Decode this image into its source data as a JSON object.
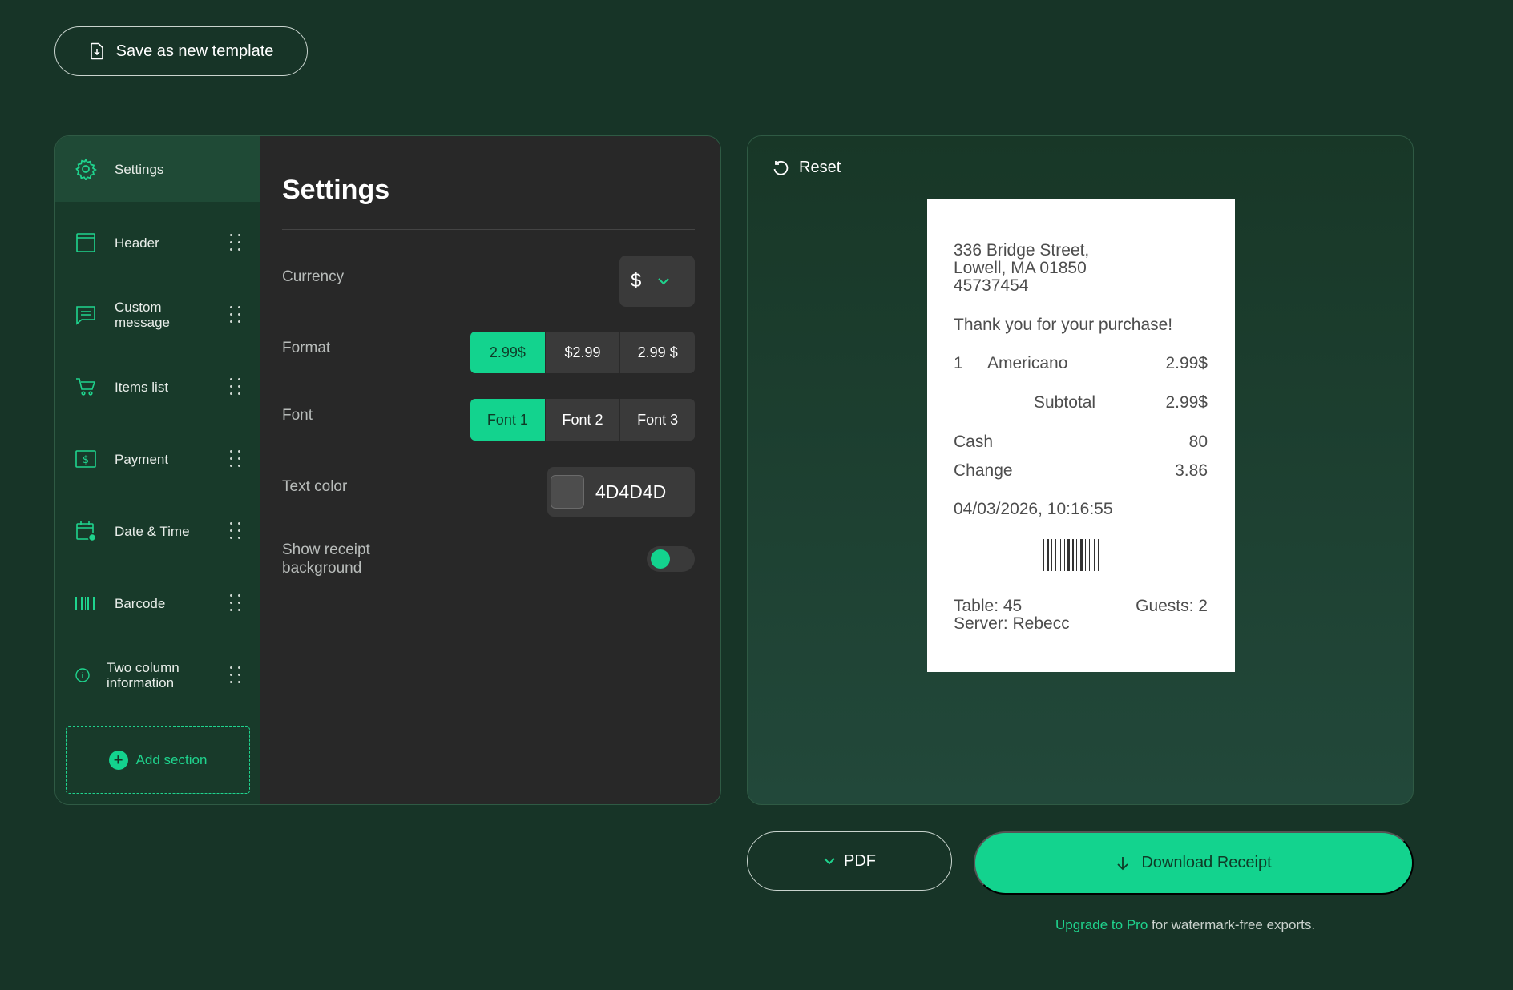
{
  "toolbar": {
    "save_template_label": "Save as new template"
  },
  "sidebar": {
    "items": [
      {
        "label": "Settings",
        "icon": "gear-icon"
      },
      {
        "label": "Header",
        "icon": "header-icon"
      },
      {
        "label": "Custom message",
        "icon": "message-icon"
      },
      {
        "label": "Items list",
        "icon": "cart-icon"
      },
      {
        "label": "Payment",
        "icon": "dollar-icon"
      },
      {
        "label": "Date & Time",
        "icon": "calendar-clock-icon"
      },
      {
        "label": "Barcode",
        "icon": "barcode-icon"
      },
      {
        "label": "Two column information",
        "icon": "info-icon"
      }
    ],
    "add_section_label": "Add section"
  },
  "settings": {
    "title": "Settings",
    "currency": {
      "label": "Currency",
      "value": "$"
    },
    "format": {
      "label": "Format",
      "options": [
        "2.99$",
        "$2.99",
        "2.99 $"
      ],
      "selected": 0
    },
    "font": {
      "label": "Font",
      "options": [
        "Font 1",
        "Font 2",
        "Font 3"
      ],
      "selected": 0
    },
    "text_color": {
      "label": "Text color",
      "value": "4D4D4D",
      "swatch": "#4D4D4D"
    },
    "show_background": {
      "label": "Show receipt background",
      "on": true
    }
  },
  "preview": {
    "reset_label": "Reset",
    "receipt": {
      "address_line1": "336 Bridge Street,",
      "address_line2": "Lowell, MA 01850",
      "address_line3": "45737454",
      "message": "Thank you for your purchase!",
      "item": {
        "qty": "1",
        "name": "Americano",
        "price": "2.99$"
      },
      "subtotal_label": "Subtotal",
      "subtotal_value": "2.99$",
      "cash_label": "Cash",
      "cash_value": "80",
      "change_label": "Change",
      "change_value": "3.86",
      "datetime": "04/03/2026, 10:16:55",
      "table": "Table: 45",
      "guests": "Guests: 2",
      "server": "Server: Rebecc"
    }
  },
  "actions": {
    "format_label": "PDF",
    "download_label": "Download Receipt",
    "upgrade_link": "Upgrade to Pro",
    "upgrade_text": " for watermark-free exports."
  },
  "colors": {
    "background": "#173427",
    "accent": "#13D38E",
    "panel": "#282828"
  }
}
